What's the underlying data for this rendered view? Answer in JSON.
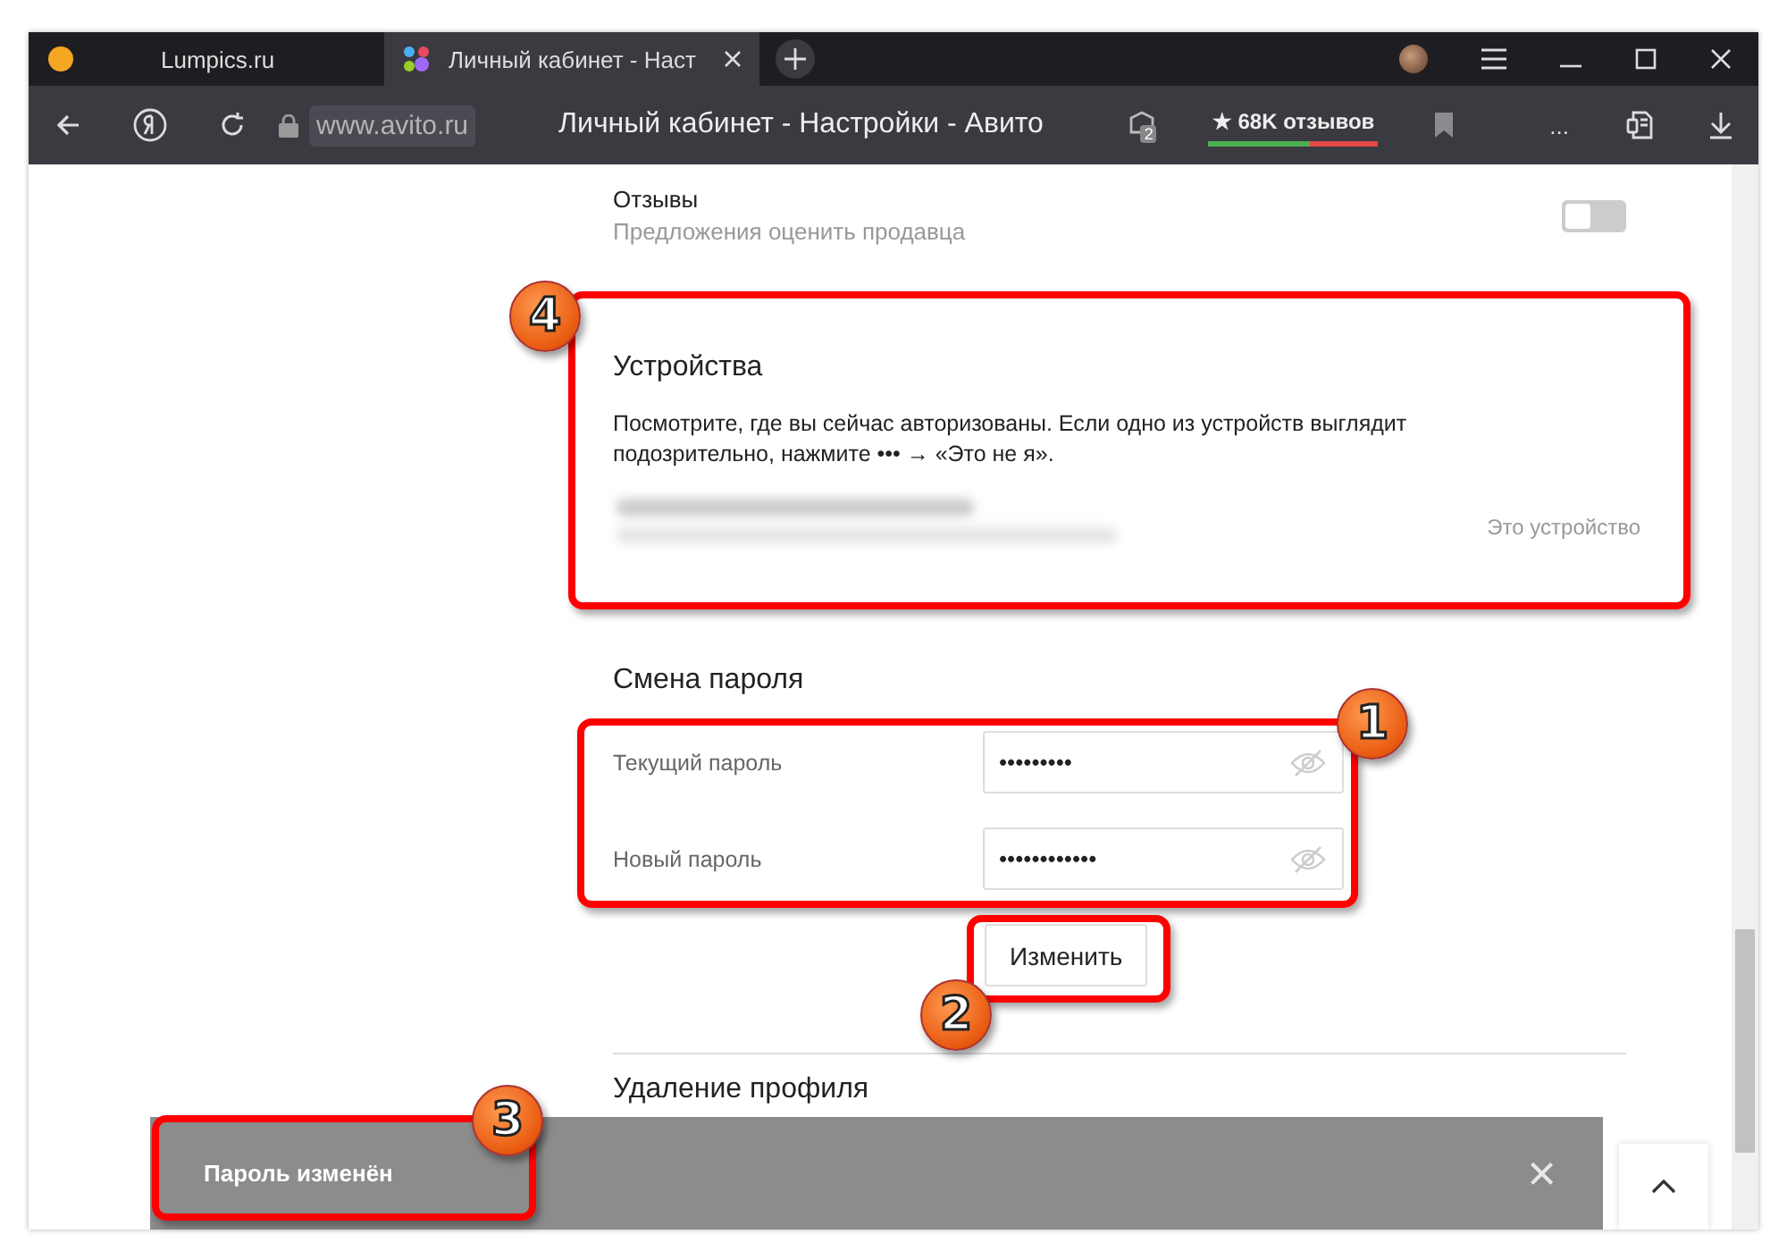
{
  "tabs": [
    {
      "title": "Lumpics.ru",
      "selected": false
    },
    {
      "title": "Личный кабинет - Наст",
      "selected": true
    }
  ],
  "toolbar": {
    "url": "www.avito.ru",
    "page_title": "Личный кабинет - Настройки - Авито",
    "extensions_count": "2",
    "reviews": "★ 68K отзывов",
    "more": "..."
  },
  "notification_setting": {
    "title": "Отзывы",
    "subtitle": "Предложения оценить продавца",
    "on": false
  },
  "devices": {
    "heading": "Устройства",
    "description": "Посмотрите, где вы сейчас авторизованы. Если одно из устройств выглядит подозрительно, нажмите ••• → «Это не я».",
    "current_label": "Это устройство"
  },
  "password_change": {
    "heading": "Смена пароля",
    "fields": [
      {
        "label": "Текущий пароль",
        "value": "•••••••••"
      },
      {
        "label": "Новый пароль",
        "value": "••••••••••••"
      }
    ],
    "submit": "Изменить"
  },
  "delete_profile": {
    "heading": "Удаление профиля"
  },
  "toast": {
    "message": "Пароль изменён",
    "close": "×"
  },
  "annotations": [
    {
      "number": "1"
    },
    {
      "number": "2"
    },
    {
      "number": "3"
    },
    {
      "number": "4"
    }
  ]
}
